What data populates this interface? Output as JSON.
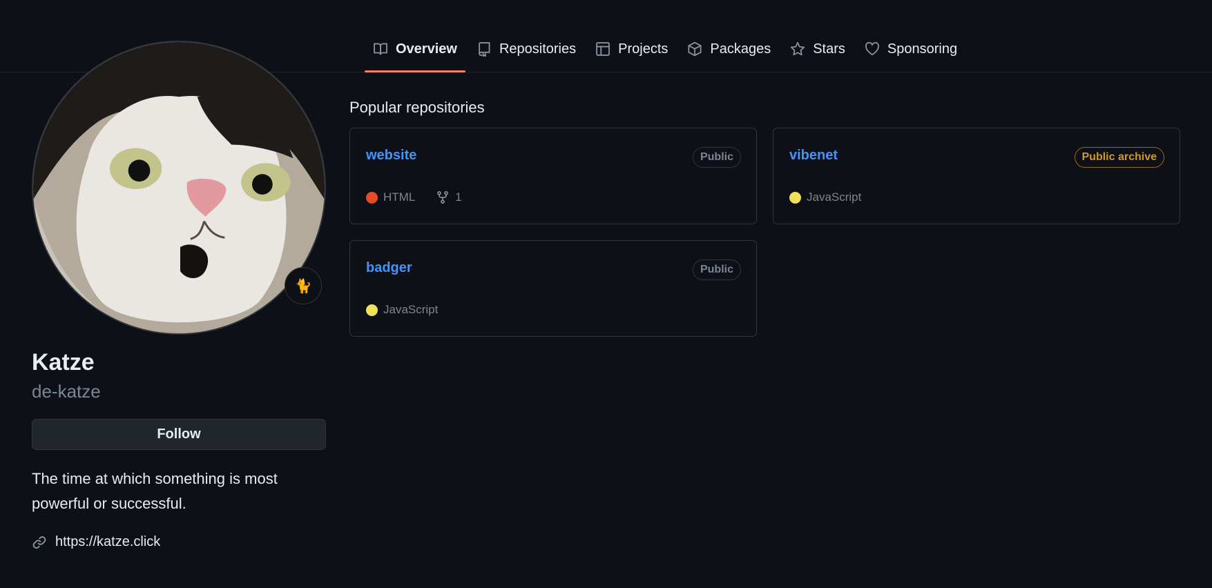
{
  "nav": {
    "tabs": [
      {
        "label": "Overview",
        "icon": "book-icon",
        "active": true
      },
      {
        "label": "Repositories",
        "icon": "repo-icon"
      },
      {
        "label": "Projects",
        "icon": "table-icon"
      },
      {
        "label": "Packages",
        "icon": "package-icon"
      },
      {
        "label": "Stars",
        "icon": "star-icon"
      },
      {
        "label": "Sponsoring",
        "icon": "heart-icon"
      }
    ]
  },
  "profile": {
    "name": "Katze",
    "login": "de-katze",
    "follow_label": "Follow",
    "bio": "The time at which something is most powerful or successful.",
    "website": "https://katze.click",
    "status_emoji": "🐈"
  },
  "popular": {
    "title": "Popular repositories",
    "repos": [
      {
        "name": "website",
        "visibility": "Public",
        "language": "HTML",
        "language_color": "#e34c26",
        "forks": "1"
      },
      {
        "name": "vibenet",
        "visibility": "Public archive",
        "language": "JavaScript",
        "language_color": "#f1e05a"
      },
      {
        "name": "badger",
        "visibility": "Public",
        "language": "JavaScript",
        "language_color": "#f1e05a"
      }
    ]
  },
  "colors": {
    "background": "#0d1117",
    "link": "#4493f8",
    "active_tab_underline": "#f78166",
    "archive": "#d29922"
  }
}
